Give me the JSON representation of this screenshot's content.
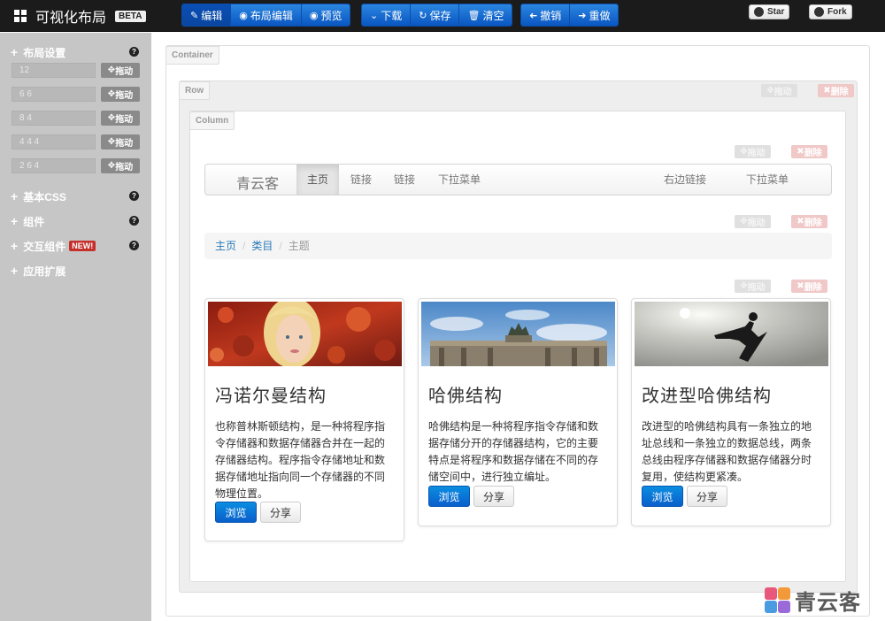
{
  "topbar": {
    "brand_title": "可视化布局",
    "beta_badge": "BETA",
    "group1": [
      {
        "label": "编辑",
        "icon": "edit-icon"
      },
      {
        "label": "布局编辑",
        "icon": "eye-icon"
      },
      {
        "label": "预览",
        "icon": "eye-icon"
      }
    ],
    "group2": [
      {
        "label": "下载",
        "icon": "chevron-down-icon"
      },
      {
        "label": "保存",
        "icon": "refresh-icon"
      },
      {
        "label": "清空",
        "icon": "trash-icon"
      }
    ],
    "group3": [
      {
        "label": "撤销",
        "icon": "arrow-left-icon"
      },
      {
        "label": "重做",
        "icon": "arrow-right-icon"
      }
    ],
    "github_star": "Star",
    "github_fork": "Fork"
  },
  "sidebar": {
    "layout_heading": "布局设置",
    "layout_rows": [
      {
        "value": "12",
        "drag_label": "拖动"
      },
      {
        "value": "6 6",
        "drag_label": "拖动"
      },
      {
        "value": "8 4",
        "drag_label": "拖动"
      },
      {
        "value": "4 4 4",
        "drag_label": "拖动"
      },
      {
        "value": "2 6 4",
        "drag_label": "拖动"
      }
    ],
    "sections": [
      {
        "label": "基本CSS",
        "has_help": true
      },
      {
        "label": "组件",
        "has_help": true
      },
      {
        "label": "交互组件",
        "badge": "NEW!",
        "has_help": true
      },
      {
        "label": "应用扩展",
        "has_help": false
      }
    ]
  },
  "canvas": {
    "container_label": "Container",
    "row_label": "Row",
    "column_label": "Column",
    "drag_label": "拖动",
    "delete_label": "删除",
    "navbar": {
      "brand": "青云客",
      "items": [
        "主页",
        "链接",
        "链接",
        "下拉菜单"
      ],
      "right_items": [
        "右边链接",
        "下拉菜单"
      ]
    },
    "breadcrumb": {
      "items": [
        "主页",
        "类目"
      ],
      "current": "主题"
    },
    "cards": [
      {
        "title": "冯诺尔曼结构",
        "text": "也称普林斯顿结构，是一种将程序指令存储器和数据存储器合并在一起的存储器结构。程序指令存储地址和数据存储地址指向同一个存储器的不同物理位置。",
        "primary": "浏览",
        "secondary": "分享"
      },
      {
        "title": "哈佛结构",
        "text": "哈佛结构是一种将程序指令存储和数据存储分开的存储器结构，它的主要特点是将程序和数据存储在不同的存储空间中，进行独立编址。",
        "primary": "浏览",
        "secondary": "分享"
      },
      {
        "title": "改进型哈佛结构",
        "text": "改进型的哈佛结构具有一条独立的地址总线和一条独立的数据总线，两条总线由程序存储器和数据存储器分时复用，使结构更紧凑。",
        "primary": "浏览",
        "secondary": "分享"
      }
    ]
  },
  "watermark": {
    "text": "青云客"
  },
  "colors": {
    "primary": "#0a6fd6",
    "topbar": "#1b1b1b",
    "sidebar": "#c6c6c6",
    "danger": "#c5302b"
  }
}
